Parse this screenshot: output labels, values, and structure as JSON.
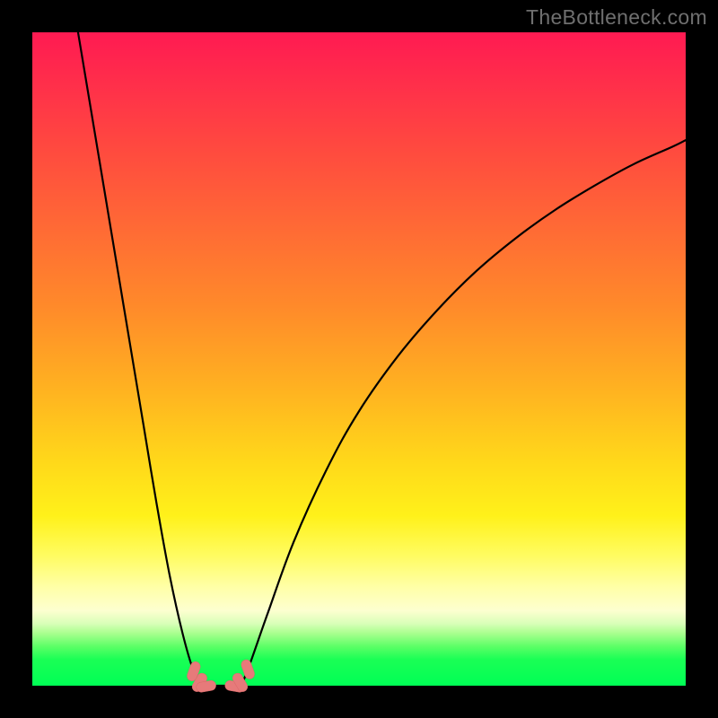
{
  "watermark": "TheBottleneck.com",
  "colors": {
    "frame": "#000000",
    "curve": "#000000",
    "marker_fill": "#e77a7a",
    "marker_stroke": "#d96a6a",
    "gradient_top": "#ff1a52",
    "gradient_bottom": "#00ff55"
  },
  "chart_data": {
    "type": "line",
    "title": "",
    "xlabel": "",
    "ylabel": "",
    "xlim": [
      0,
      100
    ],
    "ylim": [
      0,
      100
    ],
    "grid": false,
    "legend": false,
    "annotations": [],
    "series": [
      {
        "name": "left-branch",
        "x": [
          7.0,
          9.0,
          11.0,
          13.0,
          15.0,
          17.0,
          19.0,
          21.0,
          23.0,
          24.7,
          26.0
        ],
        "y": [
          100.0,
          88.0,
          76.0,
          64.0,
          52.0,
          40.0,
          28.0,
          17.0,
          8.0,
          2.2,
          0.0
        ]
      },
      {
        "name": "valley-floor",
        "x": [
          26.0,
          27.0,
          28.0,
          29.0,
          30.0,
          31.0,
          31.8
        ],
        "y": [
          0.0,
          0.0,
          0.0,
          0.0,
          0.0,
          0.0,
          0.0
        ]
      },
      {
        "name": "right-branch",
        "x": [
          31.8,
          33.0,
          36.0,
          40.0,
          45.0,
          50.0,
          56.0,
          62.0,
          68.0,
          74.0,
          80.0,
          86.0,
          92.0,
          98.0,
          100.0
        ],
        "y": [
          0.0,
          2.5,
          11.0,
          22.0,
          33.0,
          42.0,
          50.5,
          57.5,
          63.5,
          68.5,
          72.8,
          76.5,
          79.8,
          82.5,
          83.5
        ]
      }
    ],
    "markers": [
      {
        "x": 24.7,
        "y": 2.2,
        "rotation_deg": 20
      },
      {
        "x": 25.6,
        "y": 0.5,
        "rotation_deg": 30
      },
      {
        "x": 26.6,
        "y": -0.1,
        "rotation_deg": 80
      },
      {
        "x": 31.0,
        "y": -0.1,
        "rotation_deg": 100
      },
      {
        "x": 31.8,
        "y": 0.5,
        "rotation_deg": 150
      },
      {
        "x": 33.0,
        "y": 2.5,
        "rotation_deg": 160
      }
    ]
  }
}
